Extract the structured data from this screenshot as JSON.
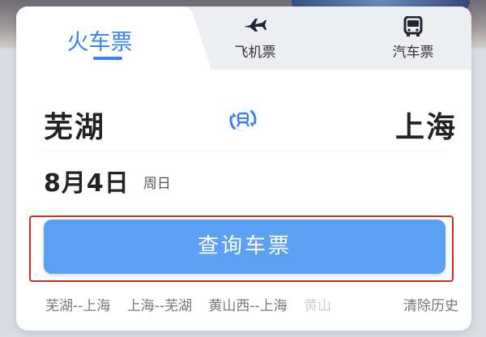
{
  "tabs": [
    {
      "label": "火车票",
      "icon": "train-icon"
    },
    {
      "label": "飞机票",
      "icon": "airplane-icon"
    },
    {
      "label": "汽车票",
      "icon": "bus-icon"
    }
  ],
  "route": {
    "from": "芜湖",
    "to": "上海",
    "swap_icon": "swap-icon"
  },
  "date": {
    "value": "8月4日",
    "weekday": "周日"
  },
  "search_button": {
    "label": "查询车票"
  },
  "history": {
    "items": [
      "芜湖--上海",
      "上海--芜湖",
      "黄山西--上海",
      "黄山"
    ],
    "clear_label": "清除历史"
  },
  "colors": {
    "accent": "#3b82f0",
    "button": "#5ba0f2",
    "highlight": "#d22b2b"
  }
}
